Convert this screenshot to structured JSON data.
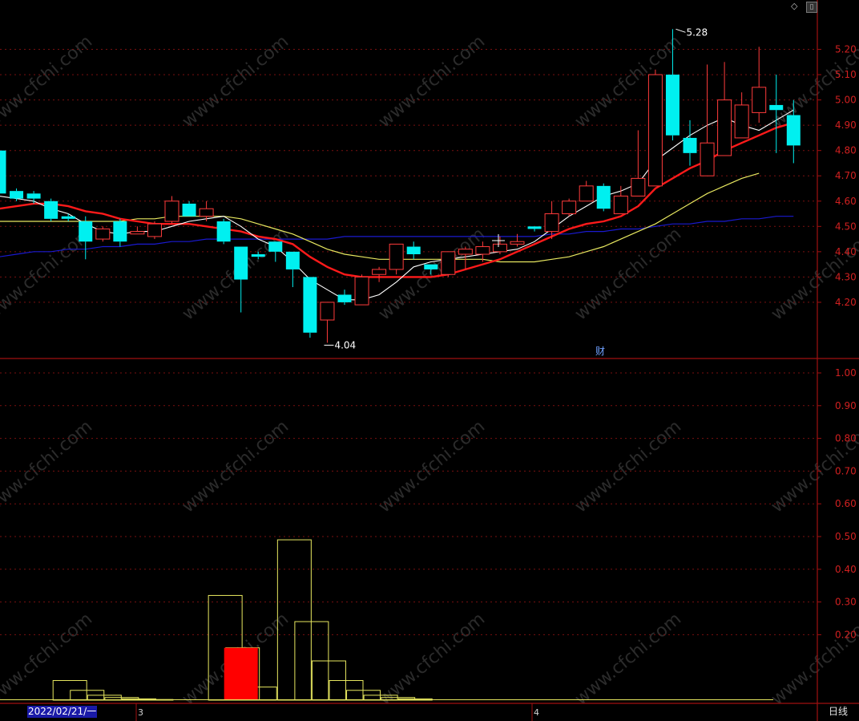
{
  "chart_data": [
    {
      "type": "candlestick",
      "panel": "price",
      "ylim": [
        4.0,
        5.3
      ],
      "y_ticks": [
        "5.20",
        "5.10",
        "5.00",
        "4.90",
        "4.80",
        "4.70",
        "4.60",
        "4.50",
        "4.40",
        "4.30",
        "4.20"
      ],
      "ohlc": [
        [
          4.8,
          4.8,
          4.63,
          4.63
        ],
        [
          4.64,
          4.65,
          4.6,
          4.61
        ],
        [
          4.63,
          4.64,
          4.59,
          4.61
        ],
        [
          4.6,
          4.61,
          4.52,
          4.53
        ],
        [
          4.54,
          4.55,
          4.52,
          4.53
        ],
        [
          4.52,
          4.54,
          4.37,
          4.44
        ],
        [
          4.45,
          4.5,
          4.44,
          4.49
        ],
        [
          4.52,
          4.53,
          4.42,
          4.44
        ],
        [
          4.47,
          4.5,
          4.47,
          4.48
        ],
        [
          4.46,
          4.52,
          4.45,
          4.51
        ],
        [
          4.52,
          4.62,
          4.51,
          4.6
        ],
        [
          4.59,
          4.6,
          4.54,
          4.54
        ],
        [
          4.54,
          4.6,
          4.52,
          4.57
        ],
        [
          4.52,
          4.53,
          4.43,
          4.44
        ],
        [
          4.42,
          4.42,
          4.16,
          4.29
        ],
        [
          4.39,
          4.4,
          4.37,
          4.38
        ],
        [
          4.44,
          4.44,
          4.36,
          4.4
        ],
        [
          4.4,
          4.4,
          4.26,
          4.33
        ],
        [
          4.3,
          4.3,
          4.06,
          4.08
        ],
        [
          4.13,
          4.2,
          4.04,
          4.2
        ],
        [
          4.23,
          4.25,
          4.19,
          4.2
        ],
        [
          4.19,
          4.31,
          4.19,
          4.3
        ],
        [
          4.31,
          4.34,
          4.28,
          4.33
        ],
        [
          4.33,
          4.43,
          4.31,
          4.43
        ],
        [
          4.42,
          4.44,
          4.37,
          4.39
        ],
        [
          4.35,
          4.35,
          4.31,
          4.33
        ],
        [
          4.31,
          4.4,
          4.3,
          4.4
        ],
        [
          4.39,
          4.42,
          4.33,
          4.41
        ],
        [
          4.39,
          4.44,
          4.36,
          4.42
        ],
        [
          4.4,
          4.46,
          4.39,
          4.43
        ],
        [
          4.43,
          4.47,
          4.42,
          4.44
        ],
        [
          4.5,
          4.5,
          4.48,
          4.49
        ],
        [
          4.48,
          4.6,
          4.45,
          4.55
        ],
        [
          4.55,
          4.61,
          4.54,
          4.6
        ],
        [
          4.6,
          4.68,
          4.6,
          4.66
        ],
        [
          4.66,
          4.67,
          4.56,
          4.57
        ],
        [
          4.55,
          4.66,
          4.55,
          4.62
        ],
        [
          4.62,
          4.88,
          4.62,
          4.69
        ],
        [
          4.66,
          5.12,
          4.66,
          5.1
        ],
        [
          5.1,
          5.28,
          4.84,
          4.86
        ],
        [
          4.85,
          4.92,
          4.74,
          4.79
        ],
        [
          4.7,
          5.14,
          4.7,
          4.83
        ],
        [
          4.78,
          5.15,
          4.78,
          5.0
        ],
        [
          4.85,
          5.03,
          4.85,
          4.98
        ],
        [
          4.95,
          5.21,
          4.91,
          5.05
        ],
        [
          4.98,
          5.1,
          4.79,
          4.96
        ],
        [
          4.94,
          5.0,
          4.75,
          4.82
        ]
      ],
      "ma_white": [
        4.62,
        4.61,
        4.6,
        4.57,
        4.55,
        4.51,
        4.48,
        4.47,
        4.48,
        4.48,
        4.5,
        4.52,
        4.53,
        4.54,
        4.5,
        4.45,
        4.42,
        4.36,
        4.29,
        4.25,
        4.21,
        4.21,
        4.23,
        4.28,
        4.34,
        4.36,
        4.37,
        4.38,
        4.39,
        4.4,
        4.41,
        4.44,
        4.49,
        4.54,
        4.58,
        4.62,
        4.64,
        4.67,
        4.76,
        4.81,
        4.86,
        4.9,
        4.93,
        4.9,
        4.88,
        4.92,
        4.96
      ],
      "ma_red": [
        4.57,
        4.58,
        4.59,
        4.59,
        4.58,
        4.56,
        4.55,
        4.53,
        4.52,
        4.51,
        4.51,
        4.51,
        4.5,
        4.49,
        4.48,
        4.46,
        4.45,
        4.43,
        4.38,
        4.34,
        4.31,
        4.3,
        4.3,
        4.3,
        4.3,
        4.3,
        4.31,
        4.33,
        4.35,
        4.37,
        4.4,
        4.43,
        4.46,
        4.49,
        4.51,
        4.52,
        4.54,
        4.58,
        4.65,
        4.69,
        4.73,
        4.76,
        4.8,
        4.83,
        4.86,
        4.89,
        4.91
      ],
      "ma_yellow": [
        4.52,
        4.52,
        4.52,
        4.52,
        4.52,
        4.52,
        4.52,
        4.52,
        4.53,
        4.53,
        4.54,
        4.54,
        4.54,
        4.54,
        4.53,
        4.51,
        4.49,
        4.47,
        4.44,
        4.41,
        4.39,
        4.38,
        4.37,
        4.37,
        4.37,
        4.37,
        4.37,
        4.37,
        4.37,
        4.36,
        4.36,
        4.36,
        4.37,
        4.38,
        4.4,
        4.42,
        4.45,
        4.48,
        4.51,
        4.55,
        4.59,
        4.63,
        4.66,
        4.69,
        4.71
      ],
      "ma_blue": [
        4.38,
        4.39,
        4.4,
        4.4,
        4.41,
        4.41,
        4.42,
        4.42,
        4.43,
        4.43,
        4.44,
        4.44,
        4.45,
        4.45,
        4.45,
        4.45,
        4.45,
        4.45,
        4.45,
        4.45,
        4.46,
        4.46,
        4.46,
        4.46,
        4.46,
        4.46,
        4.46,
        4.46,
        4.46,
        4.46,
        4.46,
        4.46,
        4.47,
        4.47,
        4.48,
        4.48,
        4.49,
        4.49,
        4.5,
        4.51,
        4.51,
        4.52,
        4.52,
        4.53,
        4.53,
        4.54,
        4.54
      ],
      "annotations": {
        "high": "5.28",
        "low": "4.04",
        "event_marker": "财"
      }
    },
    {
      "type": "bar",
      "panel": "indicator",
      "ylim": [
        0,
        1.0
      ],
      "y_ticks": [
        "1.00",
        "0.90",
        "0.80",
        "0.70",
        "0.60",
        "0.50",
        "0.40",
        "0.30",
        "0.20"
      ],
      "outline_values": [
        0,
        0,
        0,
        0,
        0.06,
        0.03,
        0.015,
        0.008,
        0.004,
        0.002,
        0,
        0,
        0,
        0.32,
        0.16,
        0.04,
        0,
        0.49,
        0.24,
        0.12,
        0.06,
        0.03,
        0.015,
        0.008,
        0.004,
        0,
        0,
        0,
        0,
        0,
        0,
        0,
        0,
        0,
        0,
        0,
        0,
        0,
        0,
        0,
        0,
        0,
        0,
        0,
        0,
        0,
        0
      ],
      "filled_red_bar": {
        "index": 14,
        "value": 0.16
      }
    }
  ],
  "footer": {
    "date_label": "2022/02/21/一",
    "month_markers": [
      "3",
      "4"
    ],
    "period_label": "日线"
  },
  "colors": {
    "up": "#ff3b3b",
    "down": "#00f0f0",
    "ma_white": "#ffffff",
    "ma_red": "#ff1a1a",
    "ma_yellow": "#e8e860",
    "ma_blue": "#1a1ad0",
    "axis": "#a01010",
    "grid": "#7a1010",
    "tick_text": "#d02020",
    "indicator_outline": "#e8e860",
    "indicator_fill": "#ff0000"
  },
  "watermark": "www.cfchi.com"
}
